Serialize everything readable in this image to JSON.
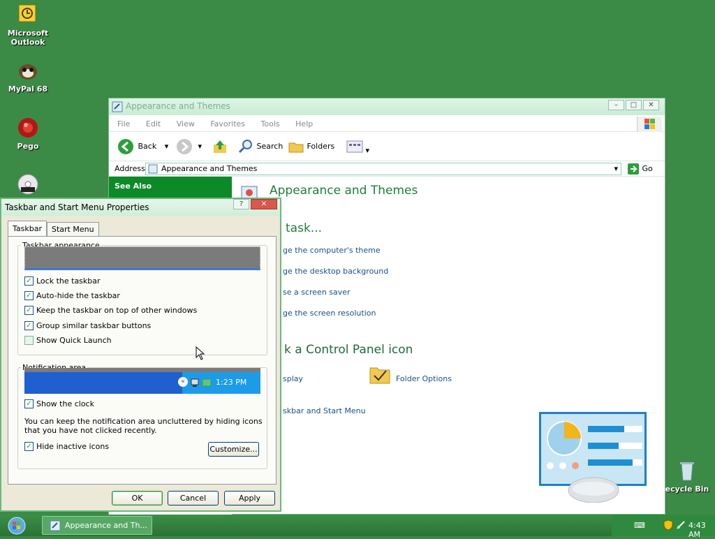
{
  "desktop": {
    "icons": [
      {
        "label": "Microsoft Outlook",
        "icon": "outlook-icon"
      },
      {
        "label": "MyPal 68",
        "icon": "mypal-icon"
      },
      {
        "label": "Pego",
        "icon": "pego-icon"
      },
      {
        "label": "",
        "icon": "dvd-icon"
      },
      {
        "label": "ecycle Bin",
        "icon": "recycle-bin-icon"
      }
    ]
  },
  "explorer": {
    "title": "Appearance and Themes",
    "menu": [
      "File",
      "Edit",
      "View",
      "Favorites",
      "Tools",
      "Help"
    ],
    "toolbar": {
      "back": "Back",
      "search": "Search",
      "folders": "Folders"
    },
    "address_label": "Address",
    "address_value": "Appearance and Themes",
    "go": "Go",
    "see_also": "See Also",
    "heading": "Appearance and Themes",
    "task_heading": "task...",
    "tasks": [
      "ge the computer's theme",
      "ge the desktop background",
      "se a screen saver",
      "ge the screen resolution"
    ],
    "cp_heading": "k a Control Panel icon",
    "cp_items": [
      "splay",
      "Folder Options",
      "skbar and Start Menu"
    ]
  },
  "dialog": {
    "title": "Taskbar and Start Menu Properties",
    "tabs": [
      "Taskbar",
      "Start Menu"
    ],
    "appearance_group": "Taskbar appearance",
    "options": [
      {
        "label": "Lock the taskbar",
        "checked": true
      },
      {
        "label": "Auto-hide the taskbar",
        "checked": true
      },
      {
        "label": "Keep the taskbar on top of other windows",
        "checked": true
      },
      {
        "label": "Group similar taskbar buttons",
        "checked": true
      },
      {
        "label": "Show Quick Launch",
        "checked": false
      }
    ],
    "notification_group": "Notification area",
    "preview_time": "1:23 PM",
    "show_clock": "Show the clock",
    "info": "You can keep the notification area uncluttered by hiding icons that you have not clicked recently.",
    "hide_inactive": "Hide inactive icons",
    "customize": "Customize...",
    "ok": "OK",
    "cancel": "Cancel",
    "apply": "Apply"
  },
  "taskbar": {
    "task_label": "Appearance and Th...",
    "clock": "4:43 AM"
  },
  "colors": {
    "desktop": "#3b8a45",
    "see_also": "#0c8a27",
    "link": "#1a4f8c"
  }
}
